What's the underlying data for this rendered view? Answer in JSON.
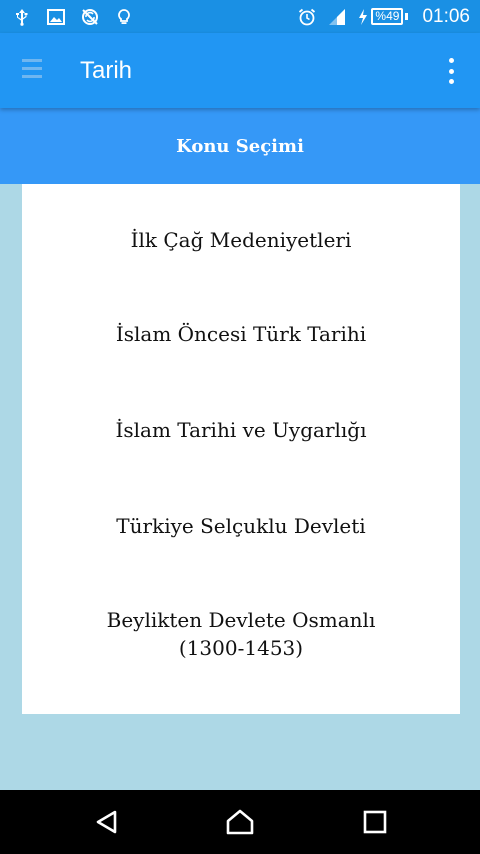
{
  "status_bar": {
    "icons": [
      "usb-icon",
      "image-icon",
      "no-sync-icon",
      "bulb-icon",
      "alarm-icon",
      "signal-icon",
      "charging-icon"
    ],
    "battery": "%49",
    "time": "01:06"
  },
  "app_bar": {
    "title": "Tarih",
    "menu_icon": "hamburger-menu-icon",
    "overflow_icon": "more-vertical-icon"
  },
  "section": {
    "title": "Konu Seçimi"
  },
  "topics": [
    {
      "line1": "İlk Çağ Medeniyetleri",
      "line2": ""
    },
    {
      "line1": "İslam Öncesi Türk Tarihi",
      "line2": ""
    },
    {
      "line1": "İslam Tarihi ve Uygarlığı",
      "line2": ""
    },
    {
      "line1": "Türkiye Selçuklu Devleti",
      "line2": ""
    },
    {
      "line1": "Beylikten Devlete Osmanlı",
      "line2": "(1300-1453)"
    }
  ],
  "nav_bar": {
    "back_icon": "back-triangle-icon",
    "home_icon": "home-icon",
    "recents_icon": "recents-square-icon"
  },
  "colors": {
    "status_bar": "#1a90e4",
    "app_bar": "#2196f3",
    "section_header": "#3598f7",
    "background": "#add8e6",
    "card": "#ffffff"
  }
}
